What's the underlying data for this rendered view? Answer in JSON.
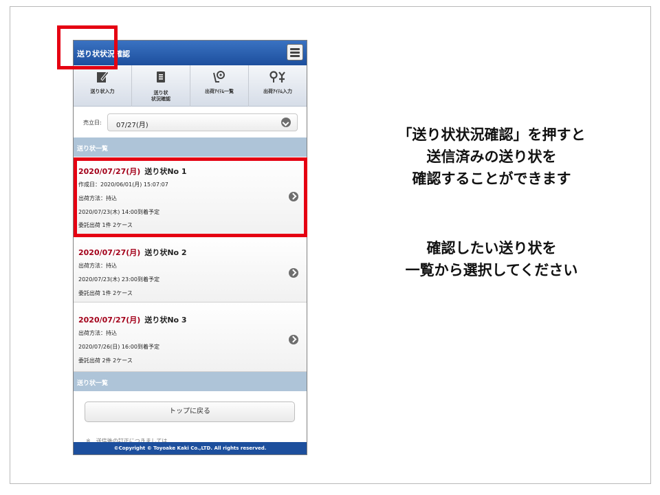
{
  "app": {
    "title": "送り状状況確認"
  },
  "tabs": [
    {
      "label": "送り状入力",
      "icon": "edit-icon"
    },
    {
      "label": "送り状\n状況確認",
      "icon": "document-icon"
    },
    {
      "label": "出荷ｱｲﾃﾑ一覧",
      "icon": "flower-search-icon"
    },
    {
      "label": "出荷ｱｲﾃﾑ入力",
      "icon": "flower-input-icon"
    }
  ],
  "date_filter": {
    "label": "売立日:",
    "value": "07/27(月)"
  },
  "section_header": "送り状一覧",
  "items": [
    {
      "date": "2020/07/27(月)",
      "number": "送り状No 1",
      "lines": [
        "作成日：2020/06/01(月) 15:07:07",
        "出荷方法：持込",
        "2020/07/23(木) 14:00到着予定",
        "委託出荷 1件 2ケース"
      ]
    },
    {
      "date": "2020/07/27(月)",
      "number": "送り状No 2",
      "lines": [
        "出荷方法：持込",
        "2020/07/23(木) 23:00到着予定",
        "委託出荷 1件 2ケース"
      ]
    },
    {
      "date": "2020/07/27(月)",
      "number": "送り状No 3",
      "lines": [
        "出荷方法：持込",
        "2020/07/26(日) 16:00到着予定",
        "委託出荷 2件 2ケース"
      ]
    }
  ],
  "footer_section_header": "送り状一覧",
  "back_button": "トップに戻る",
  "note": "※　送信後の訂正につきましては",
  "copyright": "©Copyright © Toyoake Kaki Co.,LTD. All rights reserved.",
  "instructions": {
    "first": [
      "「送り状状況確認」を押すと",
      "送信済みの送り状を",
      "確認することができます"
    ],
    "second": [
      "確認したい送り状を",
      "一覧から選択してください"
    ]
  },
  "colors": {
    "header": "#1d4f9d",
    "highlight": "#e50012",
    "date_text": "#a3001a",
    "section_bar": "#aec4d8"
  }
}
